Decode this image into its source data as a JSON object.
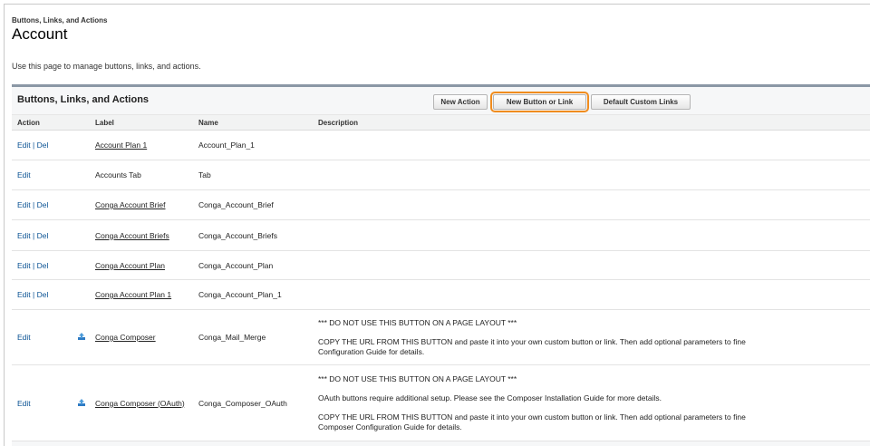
{
  "breadcrumb": "Buttons, Links, and Actions",
  "page_title": "Account",
  "intro": "Use this page to manage buttons, links, and actions.",
  "panel": {
    "title": "Buttons, Links, and Actions",
    "buttons": {
      "new_action": "New Action",
      "new_button_link": "New Button or Link",
      "default_custom_links": "Default Custom Links"
    }
  },
  "table": {
    "headers": {
      "action": "Action",
      "label": "Label",
      "name": "Name",
      "description": "Description"
    },
    "rows": [
      {
        "edit": "Edit",
        "sep": "|",
        "del": "Del",
        "label": "Account Plan 1",
        "name": "Account_Plan_1"
      },
      {
        "edit": "Edit",
        "label": "Accounts Tab",
        "name": "Tab"
      },
      {
        "edit": "Edit",
        "sep": "|",
        "del": "Del",
        "label": "Conga Account Brief",
        "name": "Conga_Account_Brief"
      },
      {
        "edit": "Edit",
        "sep": "|",
        "del": "Del",
        "label": "Conga Account Briefs",
        "name": "Conga_Account_Briefs"
      },
      {
        "edit": "Edit",
        "sep": "|",
        "del": "Del",
        "label": "Conga Account Plan",
        "name": "Conga_Account_Plan"
      },
      {
        "edit": "Edit",
        "sep": "|",
        "del": "Del",
        "label": "Conga Account Plan 1",
        "name": "Conga_Account_Plan_1"
      },
      {
        "edit": "Edit",
        "icon": "upload-icon",
        "label": "Conga Composer",
        "name": "Conga_Mail_Merge",
        "desc": [
          "*** DO NOT USE THIS BUTTON ON A PAGE LAYOUT ***",
          "COPY THE URL FROM THIS BUTTON and paste it into your own custom button or link. Then add optional parameters to fine",
          "Configuration Guide for details."
        ]
      },
      {
        "edit": "Edit",
        "icon": "upload-icon",
        "label": "Conga Composer (OAuth)",
        "name": "Conga_Composer_OAuth",
        "desc": [
          "*** DO NOT USE THIS BUTTON ON A PAGE LAYOUT ***",
          "OAuth buttons require additional setup. Please see the Composer Installation Guide for more details.",
          "COPY THE URL FROM THIS BUTTON and paste it into your own custom button or link. Then add optional parameters to fine",
          "Composer Configuration Guide for details."
        ]
      }
    ]
  },
  "colors": {
    "highlight": "#f08c1e",
    "panel_border": "#8b97a5",
    "link": "#0b5394"
  }
}
